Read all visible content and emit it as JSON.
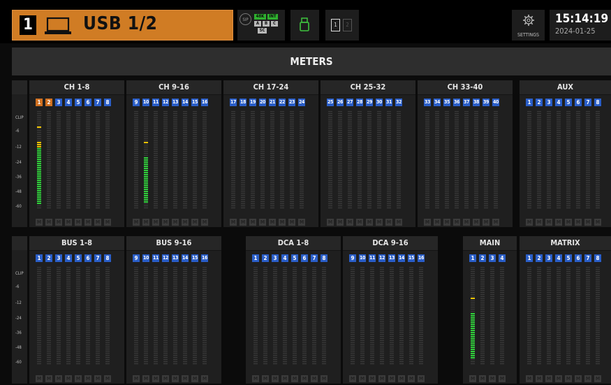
{
  "top_bar": {
    "scene_number": "1",
    "scene_name": "USB 1/2",
    "sync": {
      "sip": "SIP",
      "rate": "48K",
      "clock": "INT",
      "slots": [
        "A",
        "B",
        "C"
      ],
      "sc": "SC"
    },
    "cards": [
      "1",
      "2"
    ],
    "settings_label": "SETTINGS",
    "time": "15:14:19",
    "date": "2024-01-25"
  },
  "meters_title": "METERS",
  "mute_label": "M",
  "scale_labels": [
    "CLIP",
    "-6",
    "-12",
    "-24",
    "-36",
    "-48",
    "-60"
  ],
  "colors": {
    "accent": "#d07c24",
    "channel_blue": "#2a5ec8",
    "meter_green": "#2fd03a",
    "meter_yellow": "#f0c400"
  },
  "top_groups": [
    {
      "title": "CH 1-8",
      "channels": [
        "1",
        "2",
        "3",
        "4",
        "5",
        "6",
        "7",
        "8"
      ],
      "selected": [
        "1",
        "2"
      ],
      "levels": [
        {
          "channel": 1,
          "peak_db": -6,
          "level_db": -12
        }
      ]
    },
    {
      "title": "CH 9-16",
      "channels": [
        "9",
        "10",
        "11",
        "12",
        "13",
        "14",
        "15",
        "16"
      ],
      "selected": [],
      "levels": [
        {
          "channel": 2,
          "peak_db": -12,
          "level_db": -24
        }
      ]
    },
    {
      "title": "CH 17-24",
      "channels": [
        "17",
        "18",
        "19",
        "20",
        "21",
        "22",
        "23",
        "24"
      ],
      "selected": [],
      "levels": []
    },
    {
      "title": "CH 25-32",
      "channels": [
        "25",
        "26",
        "27",
        "28",
        "29",
        "30",
        "31",
        "32"
      ],
      "selected": [],
      "levels": []
    },
    {
      "title": "CH 33-40",
      "channels": [
        "33",
        "34",
        "35",
        "36",
        "37",
        "38",
        "39",
        "40"
      ],
      "selected": [],
      "levels": []
    },
    {
      "title": "AUX",
      "channels": [
        "1",
        "2",
        "3",
        "4",
        "5",
        "6",
        "7",
        "8"
      ],
      "selected": [],
      "levels": []
    }
  ],
  "bottom_groups": [
    {
      "title": "BUS 1-8",
      "channels": [
        "1",
        "2",
        "3",
        "4",
        "5",
        "6",
        "7",
        "8"
      ],
      "selected": [],
      "levels": []
    },
    {
      "title": "BUS 9-16",
      "channels": [
        "9",
        "10",
        "11",
        "12",
        "13",
        "14",
        "15",
        "16"
      ],
      "selected": [],
      "levels": []
    },
    {
      "title": "DCA 1-8",
      "channels": [
        "1",
        "2",
        "3",
        "4",
        "5",
        "6",
        "7",
        "8"
      ],
      "selected": [],
      "levels": []
    },
    {
      "title": "DCA 9-16",
      "channels": [
        "9",
        "10",
        "11",
        "12",
        "13",
        "14",
        "15",
        "16"
      ],
      "selected": [],
      "levels": []
    },
    {
      "title": "MAIN",
      "channels": [
        "1",
        "2",
        "3",
        "4"
      ],
      "selected": [],
      "levels": [
        {
          "channel": 1,
          "peak_db": -12,
          "level_db": -24
        }
      ]
    },
    {
      "title": "MATRIX",
      "channels": [
        "1",
        "2",
        "3",
        "4",
        "5",
        "6",
        "7",
        "8"
      ],
      "selected": [],
      "levels": []
    }
  ]
}
